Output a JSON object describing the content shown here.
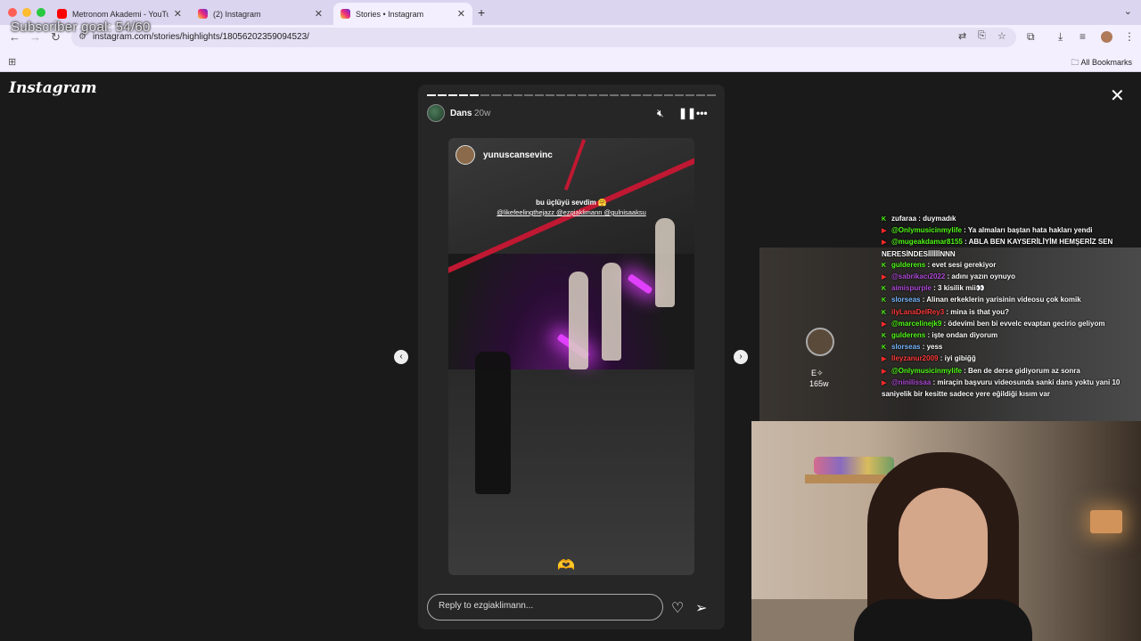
{
  "browser": {
    "tabs": [
      {
        "label": "Metronom Akademi - YouTube",
        "favicon": "youtube-icon",
        "active": false
      },
      {
        "label": "(2) Instagram",
        "favicon": "instagram-icon",
        "active": false
      },
      {
        "label": "Stories • Instagram",
        "favicon": "instagram-icon",
        "active": true
      }
    ],
    "url": "instagram.com/stories/highlights/18056202359094523/",
    "bookmarks_label": "All Bookmarks"
  },
  "overlay": {
    "subscriber_goal": "Subscriber goal: 54/60"
  },
  "instagram": {
    "logo": "Instagram",
    "story": {
      "progress_segments_total": 27,
      "progress_segments_done": 5,
      "highlight_name": "Dans",
      "age": "20w",
      "media": {
        "username": "yunuscansevinc",
        "caption": "bu üçlüyü sevdim 🤗",
        "mentions": "@likefeelingthejazz @ezgiaklimann @gulnisaaksu",
        "emoji": "🫶"
      },
      "reply_placeholder": "Reply to ezgiaklimann..."
    }
  },
  "stream": {
    "mini_story": {
      "label": "E✧",
      "count": "165w"
    },
    "chat": [
      {
        "platform": "kick",
        "user": "zufaraa",
        "user_color": "#ffffff",
        "msg": "duymadık"
      },
      {
        "platform": "youtube",
        "user": "@Onlymusicinmylife",
        "user_color": "#53fc18",
        "msg": "Ya almaları baştan hata hakları yendi"
      },
      {
        "platform": "youtube",
        "user": "@mugeakdamar8155",
        "user_color": "#53fc18",
        "msg": "ABLA BEN KAYSERİLİYİM HEMŞERİZ SEN NERESİNDESİİİİİİNNN",
        "wrap": true
      },
      {
        "platform": "kick",
        "user": "gulderens",
        "user_color": "#53fc18",
        "msg": "evet sesi gerekiyor"
      },
      {
        "platform": "youtube",
        "user": "@sabrikacı2022",
        "user_color": "#b04bd8",
        "msg": "adını yazın oynuyo"
      },
      {
        "platform": "kick",
        "user": "aimispurple",
        "user_color": "#b04bd8",
        "msg": "3 kisilik mii👀"
      },
      {
        "platform": "kick",
        "user": "slorseas",
        "user_color": "#7ab8ff",
        "msg": "Alinan erkeklerin yarisinin videosu çok komik"
      },
      {
        "platform": "kick",
        "user": "ilyLanaDelRey3",
        "user_color": "#ff3b3b",
        "msg": "mina is that you?"
      },
      {
        "platform": "youtube",
        "user": "@marcelinejk9",
        "user_color": "#53fc18",
        "msg": "ödevimi ben bi evvelc evaptan gecirio geliyom"
      },
      {
        "platform": "kick",
        "user": "gulderens",
        "user_color": "#53fc18",
        "msg": "işte ondan diyorum"
      },
      {
        "platform": "kick",
        "user": "slorseas",
        "user_color": "#7ab8ff",
        "msg": "yess"
      },
      {
        "platform": "youtube",
        "user": "lleyzanur2009",
        "user_color": "#ff3b3b",
        "msg": "iyi gibiğğ"
      },
      {
        "platform": "youtube",
        "user": "@Onlymusicinmylife",
        "user_color": "#53fc18",
        "msg": "Ben de derse gidiyorum az sonra"
      },
      {
        "platform": "youtube",
        "user": "@ninilissaa",
        "user_color": "#b04bd8",
        "msg": "miraçin başvuru videosunda sanki dans yoktu yani 10 saniyelik bir kesitte sadece yere eğildiği kısım var",
        "wrap": true
      }
    ]
  }
}
